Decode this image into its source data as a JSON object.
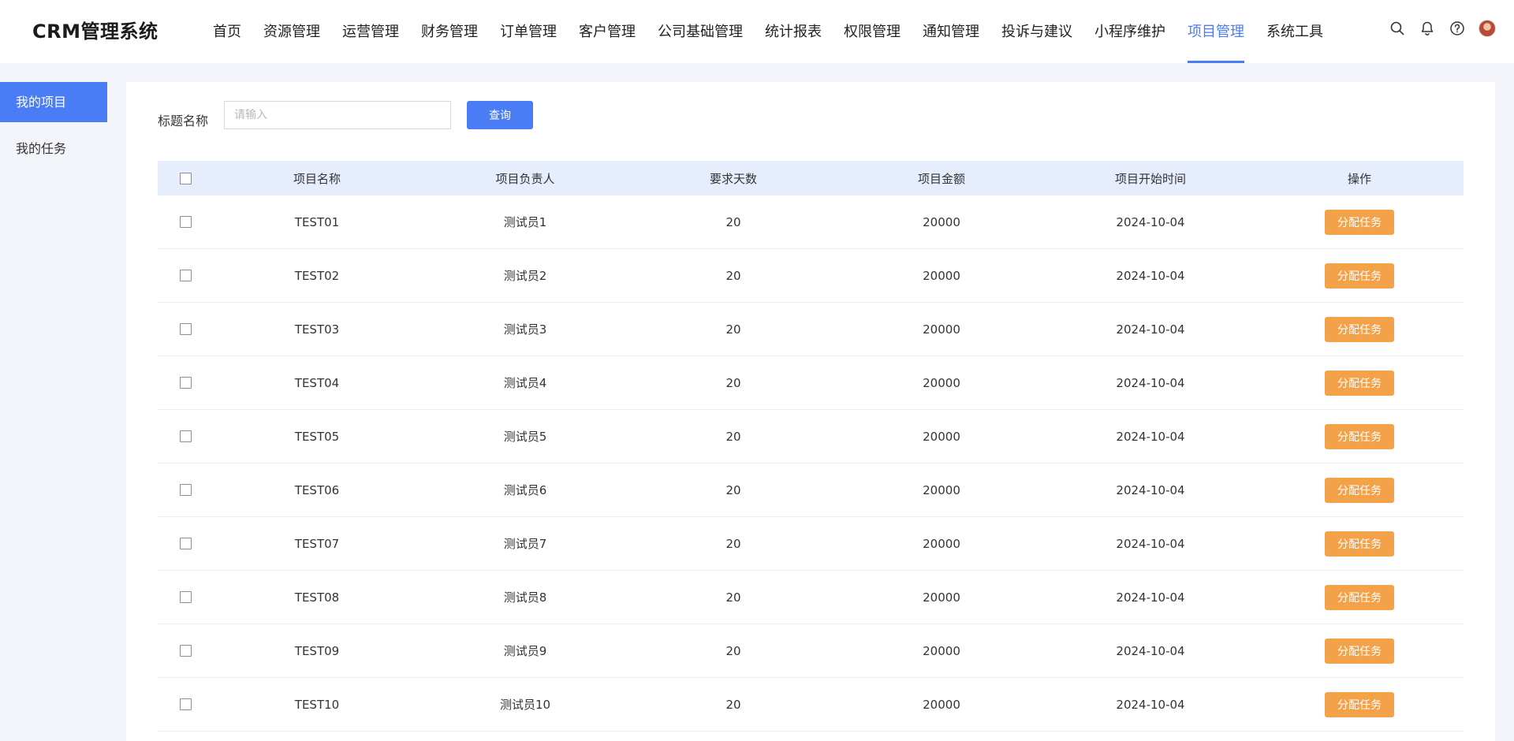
{
  "app": {
    "title": "CRM管理系统"
  },
  "nav": {
    "items": [
      "首页",
      "资源管理",
      "运营管理",
      "财务管理",
      "订单管理",
      "客户管理",
      "公司基础管理",
      "统计报表",
      "权限管理",
      "通知管理",
      "投诉与建议",
      "小程序维护",
      "项目管理",
      "系统工具"
    ],
    "active": "项目管理",
    "accent_color": "#4a7cf6"
  },
  "header_icons": [
    "search-icon",
    "bell-icon",
    "help-icon",
    "avatar"
  ],
  "sidebar": {
    "items": [
      {
        "label": "我的项目",
        "active": true
      },
      {
        "label": "我的任务",
        "active": false
      }
    ]
  },
  "search": {
    "label": "标题名称",
    "placeholder": "请输入",
    "value": "",
    "button_label": "查询"
  },
  "table": {
    "columns": [
      "项目名称",
      "项目负责人",
      "要求天数",
      "项目金额",
      "项目开始时间",
      "操作"
    ],
    "action_label": "分配任务",
    "action_color": "#f3a24a",
    "rows": [
      {
        "name": "TEST01",
        "owner": "测试员1",
        "days": "20",
        "amount": "20000",
        "start": "2024-10-04"
      },
      {
        "name": "TEST02",
        "owner": "测试员2",
        "days": "20",
        "amount": "20000",
        "start": "2024-10-04"
      },
      {
        "name": "TEST03",
        "owner": "测试员3",
        "days": "20",
        "amount": "20000",
        "start": "2024-10-04"
      },
      {
        "name": "TEST04",
        "owner": "测试员4",
        "days": "20",
        "amount": "20000",
        "start": "2024-10-04"
      },
      {
        "name": "TEST05",
        "owner": "测试员5",
        "days": "20",
        "amount": "20000",
        "start": "2024-10-04"
      },
      {
        "name": "TEST06",
        "owner": "测试员6",
        "days": "20",
        "amount": "20000",
        "start": "2024-10-04"
      },
      {
        "name": "TEST07",
        "owner": "测试员7",
        "days": "20",
        "amount": "20000",
        "start": "2024-10-04"
      },
      {
        "name": "TEST08",
        "owner": "测试员8",
        "days": "20",
        "amount": "20000",
        "start": "2024-10-04"
      },
      {
        "name": "TEST09",
        "owner": "测试员9",
        "days": "20",
        "amount": "20000",
        "start": "2024-10-04"
      },
      {
        "name": "TEST10",
        "owner": "测试员10",
        "days": "20",
        "amount": "20000",
        "start": "2024-10-04"
      }
    ]
  }
}
